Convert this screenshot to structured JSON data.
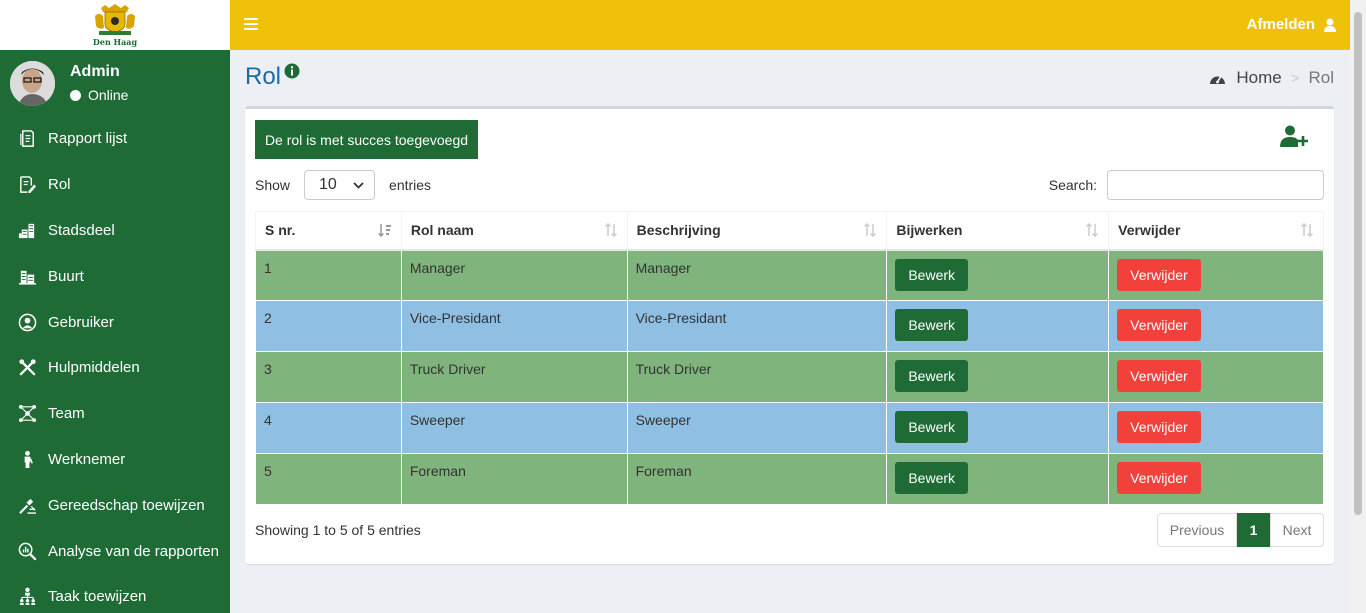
{
  "logo": {
    "text": "Den Haag"
  },
  "user": {
    "name": "Admin",
    "status": "Online"
  },
  "sidebar": {
    "items": [
      {
        "label": "Rapport lijst",
        "icon": "report-icon"
      },
      {
        "label": "Rol",
        "icon": "edit-document-icon"
      },
      {
        "label": "Stadsdeel",
        "icon": "city-icon"
      },
      {
        "label": "Buurt",
        "icon": "buildings-icon"
      },
      {
        "label": "Gebruiker",
        "icon": "user-circle-icon"
      },
      {
        "label": "Hulpmiddelen",
        "icon": "tools-icon"
      },
      {
        "label": "Team",
        "icon": "team-icon"
      },
      {
        "label": "Werknemer",
        "icon": "worker-icon"
      },
      {
        "label": "Gereedschap toewijzen",
        "icon": "assign-tools-icon"
      },
      {
        "label": "Analyse van de rapporten",
        "icon": "analytics-icon"
      },
      {
        "label": "Taak toewijzen",
        "icon": "hierarchy-icon"
      }
    ]
  },
  "header": {
    "logout_label": "Afmelden"
  },
  "page": {
    "title": "Rol"
  },
  "breadcrumb": {
    "home": "Home",
    "separator": ">",
    "current": "Rol"
  },
  "alert": {
    "message": "De rol is met succes toegevoegd"
  },
  "table_controls": {
    "show_label": "Show",
    "length_value": "10",
    "entries_label": "entries",
    "search_label": "Search:",
    "search_value": ""
  },
  "table": {
    "columns": [
      "S nr.",
      "Rol naam",
      "Beschrijving",
      "Bijwerken",
      "Verwijder"
    ],
    "rows": [
      {
        "nr": "1",
        "name": "Manager",
        "description": "Manager",
        "edit_label": "Bewerk",
        "delete_label": "Verwijder"
      },
      {
        "nr": "2",
        "name": "Vice-Presidant",
        "description": "Vice-Presidant",
        "edit_label": "Bewerk",
        "delete_label": "Verwijder"
      },
      {
        "nr": "3",
        "name": "Truck Driver",
        "description": "Truck Driver",
        "edit_label": "Bewerk",
        "delete_label": "Verwijder"
      },
      {
        "nr": "4",
        "name": "Sweeper",
        "description": "Sweeper",
        "edit_label": "Bewerk",
        "delete_label": "Verwijder"
      },
      {
        "nr": "5",
        "name": "Foreman",
        "description": "Foreman",
        "edit_label": "Bewerk",
        "delete_label": "Verwijder"
      }
    ]
  },
  "footer": {
    "info": "Showing 1 to 5 of 5 entries",
    "prev_label": "Previous",
    "page": "1",
    "next_label": "Next"
  },
  "colors": {
    "sidebar": "#1e6b36",
    "header": "#f0c10b",
    "row_green": "#7fb47c",
    "row_blue": "#8fc0e3",
    "delete": "#f2413b",
    "title": "#1a6aa8"
  }
}
